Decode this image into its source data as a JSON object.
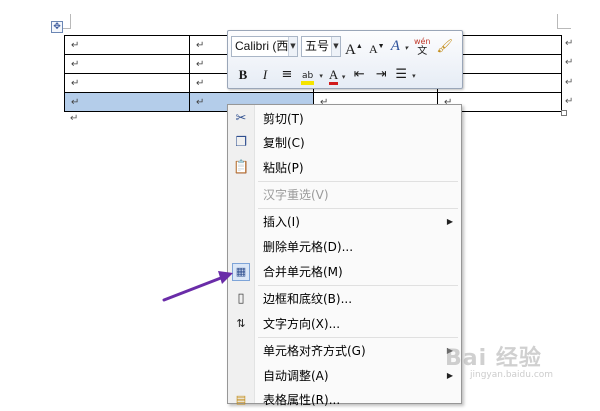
{
  "table": {
    "para_mark": "↵",
    "rows": 4,
    "cols": 4
  },
  "mini_toolbar": {
    "font_name": "Calibri (西",
    "font_size": "五号",
    "grow_font": "A",
    "shrink_font": "A",
    "styles": "A",
    "phonetic": "wén",
    "bold": "B",
    "italic": "I",
    "font_color": "A"
  },
  "context_menu": {
    "items": [
      {
        "label": "剪切(T)",
        "icon": "scissors-icon",
        "enabled": true
      },
      {
        "label": "复制(C)",
        "icon": "copy-icon",
        "enabled": true
      },
      {
        "label": "粘贴(P)",
        "icon": "paste-icon",
        "enabled": true
      },
      {
        "label": "汉字重选(V)",
        "icon": "",
        "enabled": false
      },
      {
        "label": "插入(I)",
        "icon": "",
        "enabled": true,
        "submenu": true
      },
      {
        "label": "删除单元格(D)...",
        "icon": "",
        "enabled": true
      },
      {
        "label": "合并单元格(M)",
        "icon": "merge-cells-icon",
        "enabled": true
      },
      {
        "label": "边框和底纹(B)...",
        "icon": "borders-icon",
        "enabled": true
      },
      {
        "label": "文字方向(X)...",
        "icon": "text-direction-icon",
        "enabled": true
      },
      {
        "label": "单元格对齐方式(G)",
        "icon": "",
        "enabled": true,
        "submenu": true
      },
      {
        "label": "自动调整(A)",
        "icon": "",
        "enabled": true,
        "submenu": true
      },
      {
        "label": "表格属性(R)...",
        "icon": "table-properties-icon",
        "enabled": true
      }
    ],
    "submenu_arrow": "▶"
  },
  "watermark": {
    "brand": "Bai 经验",
    "url": "jingyan.baidu.com"
  },
  "colors": {
    "selection": "#b4cdea",
    "arrow": "#6a2ca8",
    "highlight": "#f5e400",
    "font_red": "#d11b1b"
  }
}
